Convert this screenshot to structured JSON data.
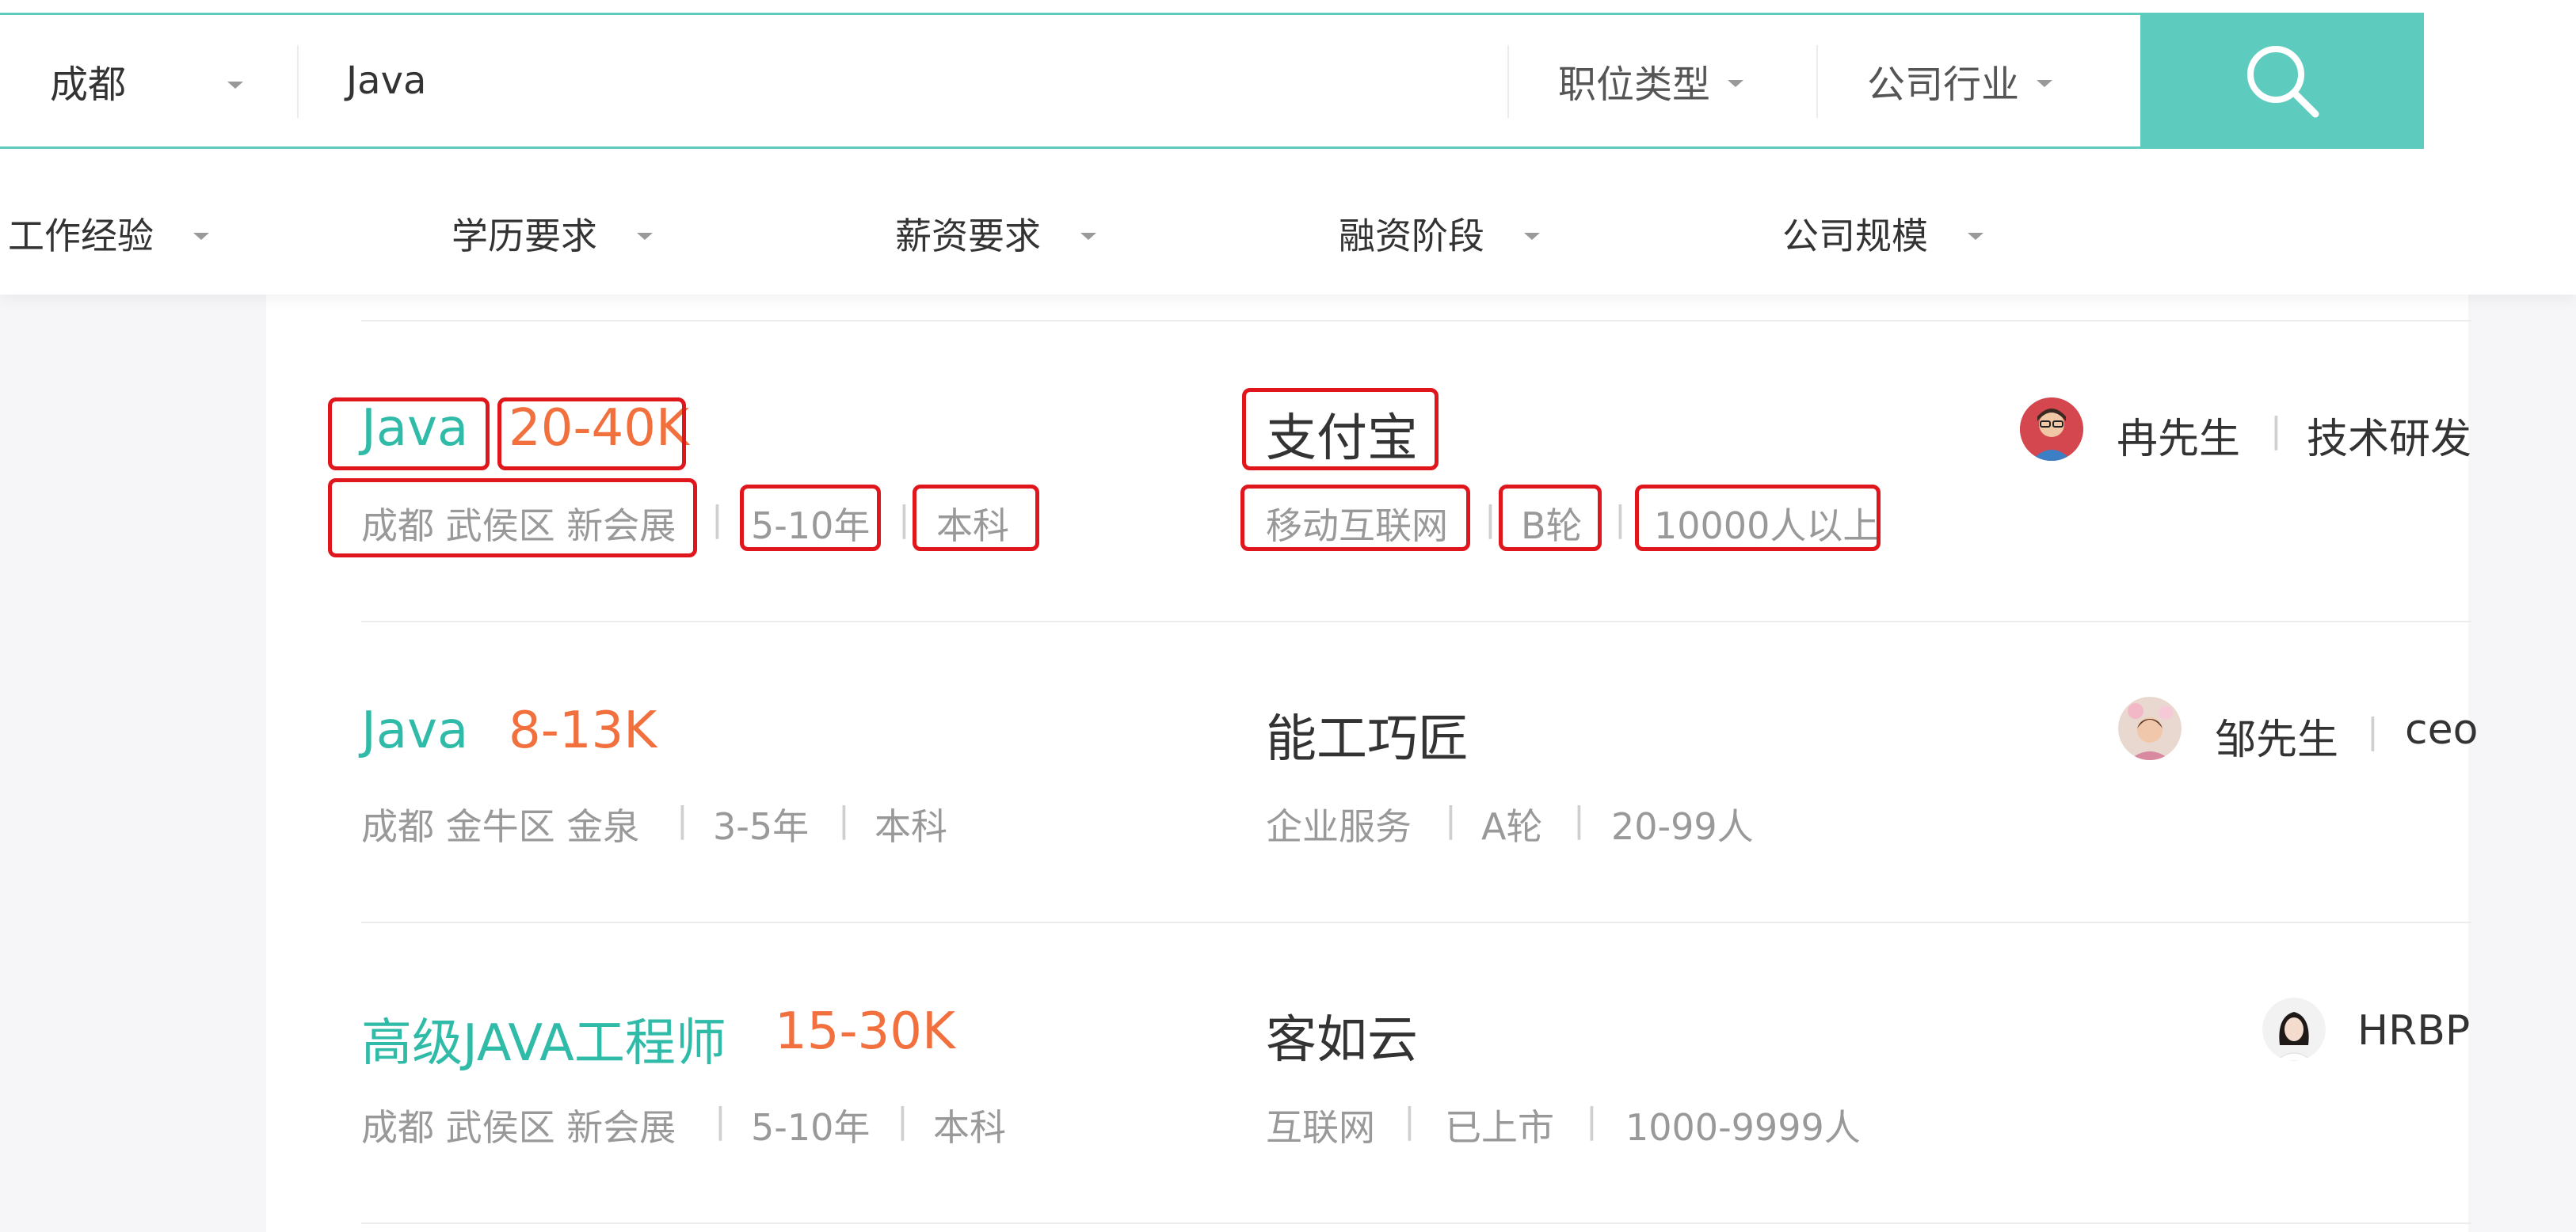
{
  "search": {
    "city": "成都",
    "keyword": "Java",
    "job_type": "职位类型",
    "industry": "公司行业"
  },
  "filters": [
    "工作经验",
    "学历要求",
    "薪资要求",
    "融资阶段",
    "公司规模"
  ],
  "jobs": [
    {
      "title": "Java",
      "salary": "20-40K",
      "location": "成都 武侯区 新会展",
      "experience": "5-10年",
      "education": "本科",
      "company": "支付宝",
      "industry": "移动互联网",
      "funding": "B轮",
      "size": "10000人以上",
      "hr_name": "冉先生",
      "hr_title": "技术研发"
    },
    {
      "title": "Java",
      "salary": "8-13K",
      "location": "成都 金牛区 金泉",
      "experience": "3-5年",
      "education": "本科",
      "company": "能工巧匠",
      "industry": "企业服务",
      "funding": "A轮",
      "size": "20-99人",
      "hr_name": "邹先生",
      "hr_title": "ceo"
    },
    {
      "title": "高级JAVA工程师",
      "salary": "15-30K",
      "location": "成都 武侯区 新会展",
      "experience": "5-10年",
      "education": "本科",
      "company": "客如云",
      "industry": "互联网",
      "funding": "已上市",
      "size": "1000-9999人",
      "hr_name": "",
      "hr_title": "HRBP"
    }
  ],
  "separator": "|",
  "colors": {
    "accent": "#5dccbf",
    "title": "#30bba8",
    "salary": "#f2703d",
    "highlight": "#e0161d"
  }
}
